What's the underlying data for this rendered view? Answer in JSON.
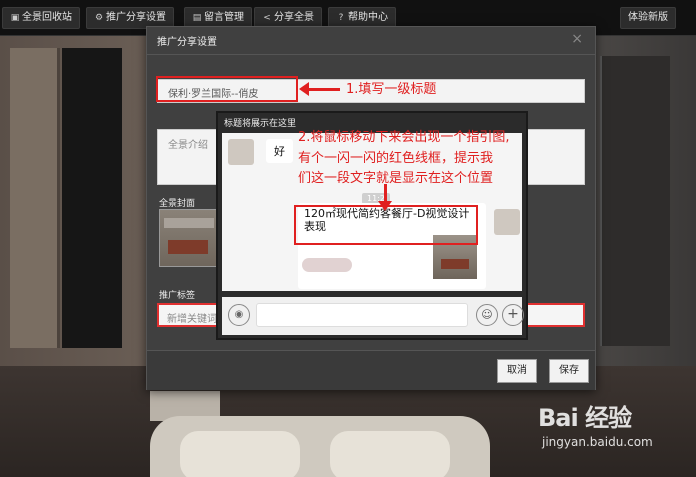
{
  "toolbar": {
    "items": [
      {
        "label": "全景回收站",
        "icon": "recycle-icon"
      },
      {
        "label": "推广分享设置",
        "icon": "gear-icon"
      },
      {
        "label": "留言管理",
        "icon": "comment-icon"
      },
      {
        "label": "分享全景",
        "icon": "share-icon"
      },
      {
        "label": "帮助中心",
        "icon": "question-icon"
      }
    ],
    "right_button": "体验新版"
  },
  "dialog": {
    "title": "推广分享设置",
    "close": "×",
    "title_field_value": "保利·罗兰国际--俏皮",
    "desc_placeholder": "全景介绍",
    "cover_label": "全景封面",
    "tags_label": "推广标签",
    "tags_placeholder": "新增关键词",
    "cancel": "取消",
    "save": "保存"
  },
  "preview": {
    "header": "标题将展示在这里",
    "message": "好",
    "time": "11:2",
    "card_title": "120㎡现代简约客餐厅-D视觉设计表现"
  },
  "annotations": {
    "step1": "1.填写一级标题",
    "step2_lines": [
      "2.将鼠标移动下来会出现一个指引图,",
      "有个一闪一闪的红色线框，提示我",
      "们这一段文字就是显示在这个位置"
    ]
  },
  "watermark": {
    "logo": "Bai 经验",
    "site": "jingyan.baidu.com"
  },
  "colors": {
    "annotation_red": "#e02020",
    "dialog_bg": "#404040",
    "toolbar_bg": "#111111"
  }
}
